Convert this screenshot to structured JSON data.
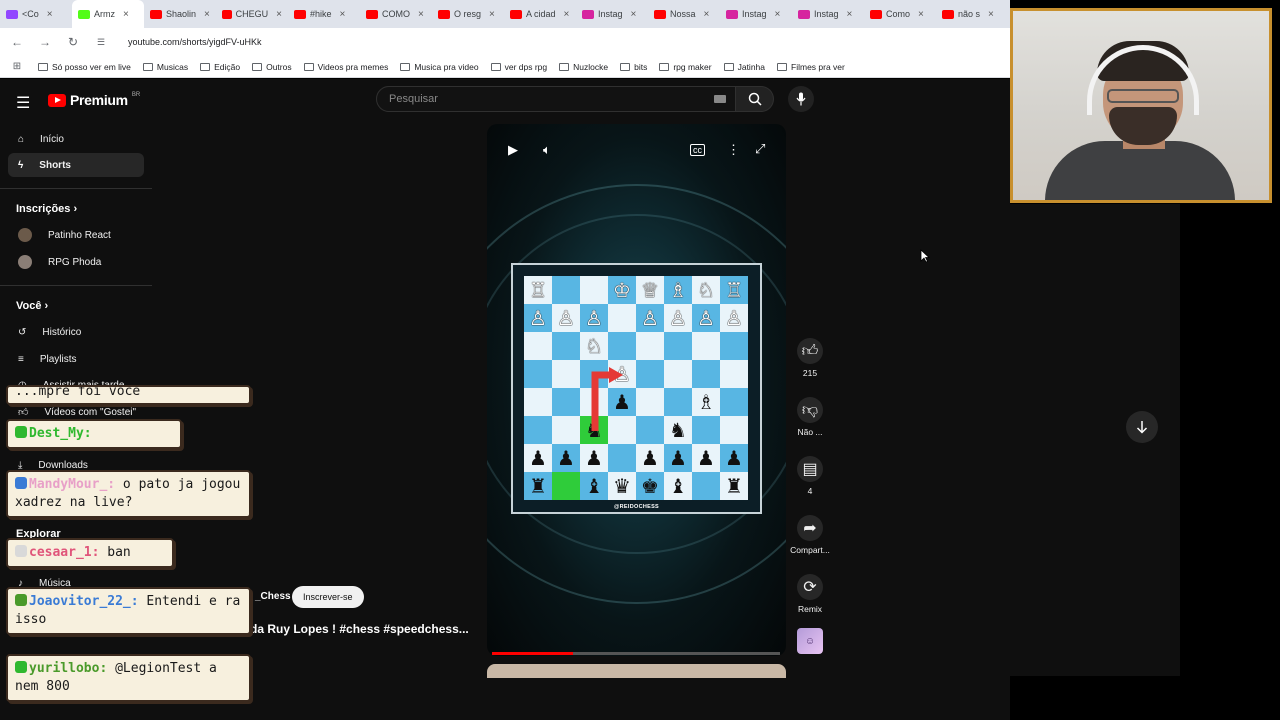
{
  "browser": {
    "tabs": [
      {
        "label": "<Co",
        "color": "#9146ff",
        "active": false
      },
      {
        "label": "Armz",
        "color": "#53fc18",
        "active": true
      },
      {
        "label": "Shaolin",
        "color": "#ff0000",
        "active": false
      },
      {
        "label": "CHEGU",
        "color": "#ff0000",
        "active": false
      },
      {
        "label": "#hike",
        "color": "#ff0000",
        "active": false
      },
      {
        "label": "COMO",
        "color": "#ff0000",
        "active": false
      },
      {
        "label": "O resg",
        "color": "#ff0000",
        "active": false
      },
      {
        "label": "A cidad",
        "color": "#ff0000",
        "active": false
      },
      {
        "label": "Instag",
        "color": "#d6249f",
        "active": false
      },
      {
        "label": "Nossa",
        "color": "#ff0000",
        "active": false
      },
      {
        "label": "Instag",
        "color": "#d6249f",
        "active": false
      },
      {
        "label": "Instag",
        "color": "#d6249f",
        "active": false
      },
      {
        "label": "Como",
        "color": "#ff0000",
        "active": false
      },
      {
        "label": "não s",
        "color": "#ff0000",
        "active": false
      }
    ],
    "url": "youtube.com/shorts/yigdFV-uHKk",
    "bookmarks": [
      "Só posso ver em live",
      "Musicas",
      "Edição",
      "Outros",
      "Videos pra memes",
      "Musica pra video",
      "ver dps rpg",
      "Nuzlocke",
      "bits",
      "rpg maker",
      "Jatinha",
      "Filmes pra ver"
    ]
  },
  "youtube": {
    "logo_text": "Premium",
    "logo_region": "BR",
    "search_placeholder": "Pesquisar",
    "sidebar": {
      "home": "Início",
      "shorts": "Shorts",
      "subscriptions_header": "Inscrições",
      "subscriptions": [
        "Patinho React",
        "RPG Phoda"
      ],
      "you_header": "Você",
      "history": "Histórico",
      "playlists": "Playlists",
      "watch_later": "Assistir mais tarde",
      "liked": "Vídeos com \"Gostei\"",
      "downloads": "Downloads",
      "explore_header": "Explorar",
      "music": "Música"
    },
    "short": {
      "watermark": "@REIDOCHESS",
      "channel": "_Chess",
      "subscribe": "Inscrever-se",
      "title": "da Ruy Lopes ! #chess #speedchess...",
      "progress": 0.28
    },
    "actions": {
      "likes": "215",
      "dislike": "Não ...",
      "comments": "4",
      "share": "Compart...",
      "remix": "Remix"
    }
  },
  "chess_board": {
    "ranks": [
      [
        "♖",
        "",
        "",
        "♔",
        "♕",
        "♗",
        "♘",
        "♖"
      ],
      [
        "♙",
        "♙",
        "♙",
        "",
        "♙",
        "♙",
        "♙",
        "♙"
      ],
      [
        "",
        "",
        "♘",
        "",
        "",
        "",
        "",
        ""
      ],
      [
        "",
        "",
        "",
        "♙",
        "",
        "",
        "",
        ""
      ],
      [
        "",
        "",
        "",
        "♟",
        "",
        "",
        "♗",
        ""
      ],
      [
        "",
        "",
        "♞",
        "",
        "",
        "♞",
        "",
        ""
      ],
      [
        "♟",
        "♟",
        "♟",
        "",
        "♟",
        "♟",
        "♟",
        "♟"
      ],
      [
        "♜",
        "",
        "♝",
        "♛",
        "♚",
        "♝",
        "",
        "♜"
      ]
    ],
    "highlight": [
      [
        5,
        2
      ],
      [
        7,
        1
      ]
    ]
  },
  "chat": [
    {
      "user": "",
      "message": "...mpre foi você",
      "user_color": "#1a1a1a"
    },
    {
      "user": "Dest_My:",
      "message": "",
      "user_color": "#2fb82f"
    },
    {
      "user": "MandyMour_:",
      "message": "o pato ja jogou xadrez na live?",
      "user_color": "#e8a0c8"
    },
    {
      "user": "cesaar_1:",
      "message": "ban",
      "user_color": "#e0557a"
    },
    {
      "user": "Joaovitor_22_:",
      "message": "Entendi e ra isso",
      "user_color": "#3a7bd5"
    },
    {
      "user": "yurillobo:",
      "message": "@LegionTest a nem 800",
      "user_color": "#4a9a2a"
    }
  ]
}
